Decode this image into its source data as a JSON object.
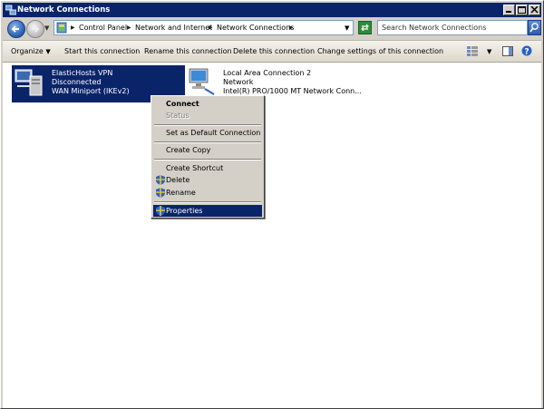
{
  "window": {
    "title": "Network Connections"
  },
  "address_bar": {
    "crumbs": [
      "Control Panel",
      "Network and Internet",
      "Network Connections"
    ],
    "search_placeholder": "Search Network Connections"
  },
  "toolbar": {
    "organize": "Organize",
    "start": "Start this connection",
    "rename": "Rename this connection",
    "delete": "Delete this connection",
    "change": "Change settings of this connection"
  },
  "connections": [
    {
      "name": "ElasticHosts VPN",
      "status": "Disconnected",
      "device": "WAN Miniport (IKEv2)",
      "selected": true
    },
    {
      "name": "Local Area Connection 2",
      "status": "Network",
      "device": "Intel(R) PRO/1000 MT Network Conn..."
    }
  ],
  "context_menu": {
    "items": [
      {
        "label": "Connect",
        "style": "bold"
      },
      {
        "label": "Status",
        "style": "disabled"
      },
      {
        "label": "Set as Default Connection"
      },
      {
        "label": "Create Copy"
      },
      {
        "label": "Create Shortcut"
      },
      {
        "label": "Delete",
        "icon": "shield-icon"
      },
      {
        "label": "Rename",
        "icon": "shield-icon"
      },
      {
        "label": "Properties",
        "icon": "shield-icon",
        "highlighted": true
      }
    ]
  },
  "colors": {
    "title_bar": "#0a246a",
    "selection": "#0a246a",
    "face": "#d4d0c8"
  }
}
